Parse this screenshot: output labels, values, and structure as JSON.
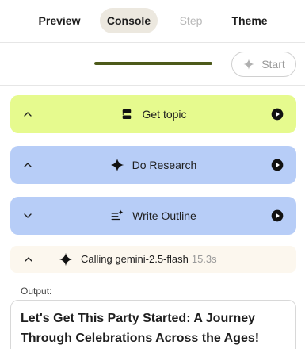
{
  "tabs": {
    "preview": "Preview",
    "console": "Console",
    "step": "Step",
    "theme": "Theme",
    "active": "Console"
  },
  "runbar": {
    "progress_fraction": 1.0,
    "start_label": "Start"
  },
  "steps": [
    {
      "title": "Get topic",
      "icon": "input-icon",
      "expanded": true,
      "color": "#e6fa8e"
    },
    {
      "title": "Do Research",
      "icon": "sparkle-icon",
      "expanded": true,
      "color": "#b7cdf7"
    },
    {
      "title": "Write Outline",
      "icon": "outline-icon",
      "expanded": false,
      "color": "#b7cdf7"
    }
  ],
  "call": {
    "label": "Calling gemini-2.5-flash",
    "duration": "15.3s"
  },
  "output": {
    "label": "Output:",
    "text": "Let's Get This Party Started: A Journey Through Celebrations Across the Ages!"
  },
  "colors": {
    "accent_progress": "#4d5a1a",
    "tab_active_bg": "#ece8df",
    "call_row_bg": "#fcf7ee"
  }
}
